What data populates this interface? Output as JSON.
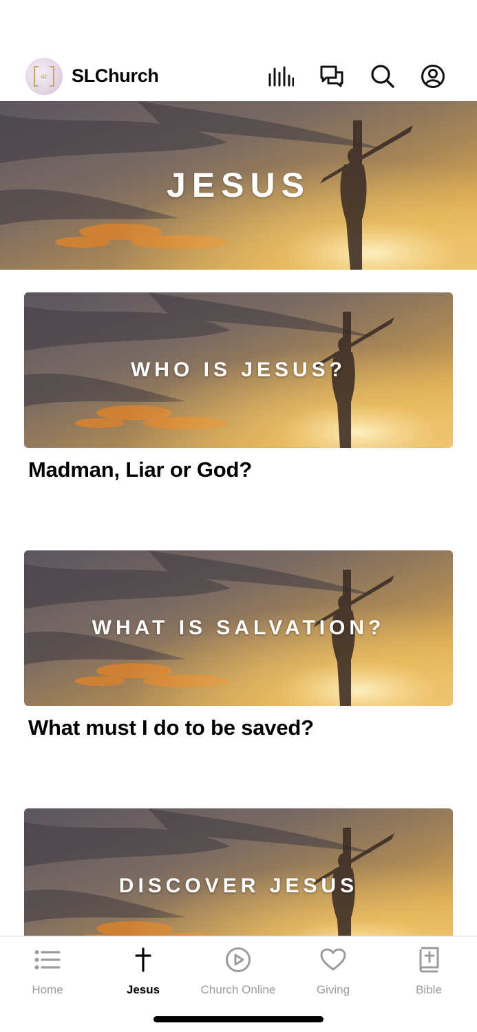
{
  "header": {
    "title": "SLChurch",
    "logo_text": "slc",
    "icons": [
      "bars-chart-icon",
      "chat-bubbles-icon",
      "search-icon",
      "account-icon"
    ]
  },
  "hero": {
    "text": "JESUS"
  },
  "cards": [
    {
      "banner": "WHO IS JESUS?",
      "title": "Madman, Liar or God?"
    },
    {
      "banner": "WHAT IS SALVATION?",
      "title": "What must I do to be saved?"
    },
    {
      "banner": "DISCOVER JESUS",
      "title": ""
    }
  ],
  "tabbar": {
    "tabs": [
      {
        "label": "Home",
        "icon": "list-icon",
        "active": false
      },
      {
        "label": "Jesus",
        "icon": "cross-icon",
        "active": true
      },
      {
        "label": "Church Online",
        "icon": "play-circle-icon",
        "active": false
      },
      {
        "label": "Giving",
        "icon": "heart-icon",
        "active": false
      },
      {
        "label": "Bible",
        "icon": "bible-icon",
        "active": false
      }
    ]
  },
  "colors": {
    "accent": "#000000",
    "inactive": "#9b9b9b",
    "sunset_orange": "#e08a2c",
    "sky_dark": "#4a4750"
  }
}
